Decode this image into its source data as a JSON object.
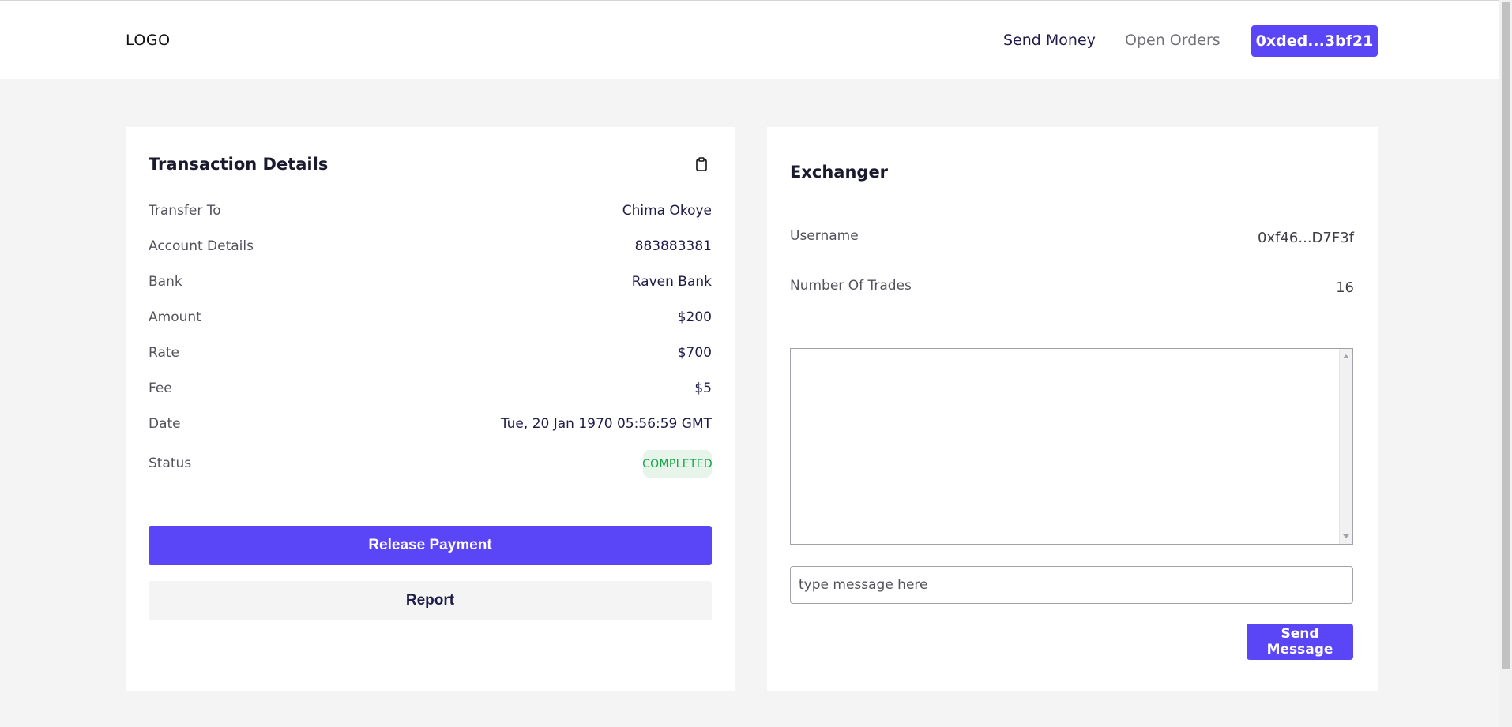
{
  "header": {
    "logo": "LOGO",
    "nav": {
      "send_money": "Send Money",
      "open_orders": "Open Orders"
    },
    "wallet_address": "0xded...3bf21"
  },
  "transaction": {
    "title": "Transaction Details",
    "rows": [
      {
        "label": "Transfer To",
        "value": "Chima Okoye"
      },
      {
        "label": "Account Details",
        "value": "883883381"
      },
      {
        "label": "Bank",
        "value": "Raven Bank"
      },
      {
        "label": "Amount",
        "value": "$200"
      },
      {
        "label": "Rate",
        "value": "$700"
      },
      {
        "label": "Fee",
        "value": "$5"
      },
      {
        "label": "Date",
        "value": "Tue, 20 Jan 1970 05:56:59 GMT"
      }
    ],
    "status_label": "Status",
    "status_value": "COMPLETED",
    "release_label": "Release Payment",
    "report_label": "Report"
  },
  "exchanger": {
    "title": "Exchanger",
    "username_label": "Username",
    "username_value": "0xf46...D7F3f",
    "trades_label": "Number Of Trades",
    "trades_value": "16",
    "message_placeholder": "type message here",
    "send_label": "Send Message"
  },
  "colors": {
    "primary": "#5b46f7",
    "background": "#f4f4f5",
    "status_completed_bg": "#e6f4ea",
    "status_completed_text": "#16a34a"
  }
}
